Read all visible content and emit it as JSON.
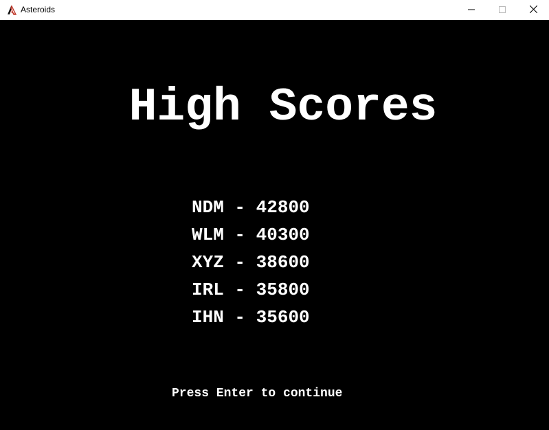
{
  "window": {
    "title": "Asteroids",
    "icon": "asteroids-app-icon",
    "controls": {
      "minimize_icon": "minimize-icon",
      "maximize_icon": "maximize-icon",
      "close_icon": "close-icon"
    }
  },
  "game": {
    "heading": "High Scores",
    "scores": [
      {
        "initials": "NDM",
        "separator": "-",
        "score": "42800"
      },
      {
        "initials": "WLM",
        "separator": "-",
        "score": "40300"
      },
      {
        "initials": "XYZ",
        "separator": "-",
        "score": "38600"
      },
      {
        "initials": "IRL",
        "separator": "-",
        "score": "35800"
      },
      {
        "initials": "IHN",
        "separator": "-",
        "score": "35600"
      }
    ],
    "prompt": "Press Enter to continue"
  },
  "colors": {
    "background": "#000000",
    "text": "#ffffff",
    "titlebar": "#ffffff",
    "icon_accent": "#c0392b"
  }
}
